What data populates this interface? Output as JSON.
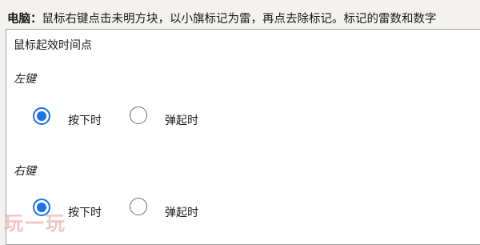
{
  "intro": {
    "lead": "电脑：",
    "text": "鼠标右键点击未明方块，以小旗标记为雷，再点去除标记。标记的雷数和数字"
  },
  "panel": {
    "title": "鼠标起效时间点",
    "sections": [
      {
        "label": "左键",
        "options": [
          {
            "label": "按下时",
            "checked": true
          },
          {
            "label": "弹起时",
            "checked": false
          }
        ]
      },
      {
        "label": "右键",
        "options": [
          {
            "label": "按下时",
            "checked": true
          },
          {
            "label": "弹起时",
            "checked": false
          }
        ]
      }
    ]
  },
  "watermark": "玩一玩",
  "colors": {
    "accent": "#1a73e8",
    "background": "#f4f2ee",
    "panel_border": "#9e9e9e"
  }
}
